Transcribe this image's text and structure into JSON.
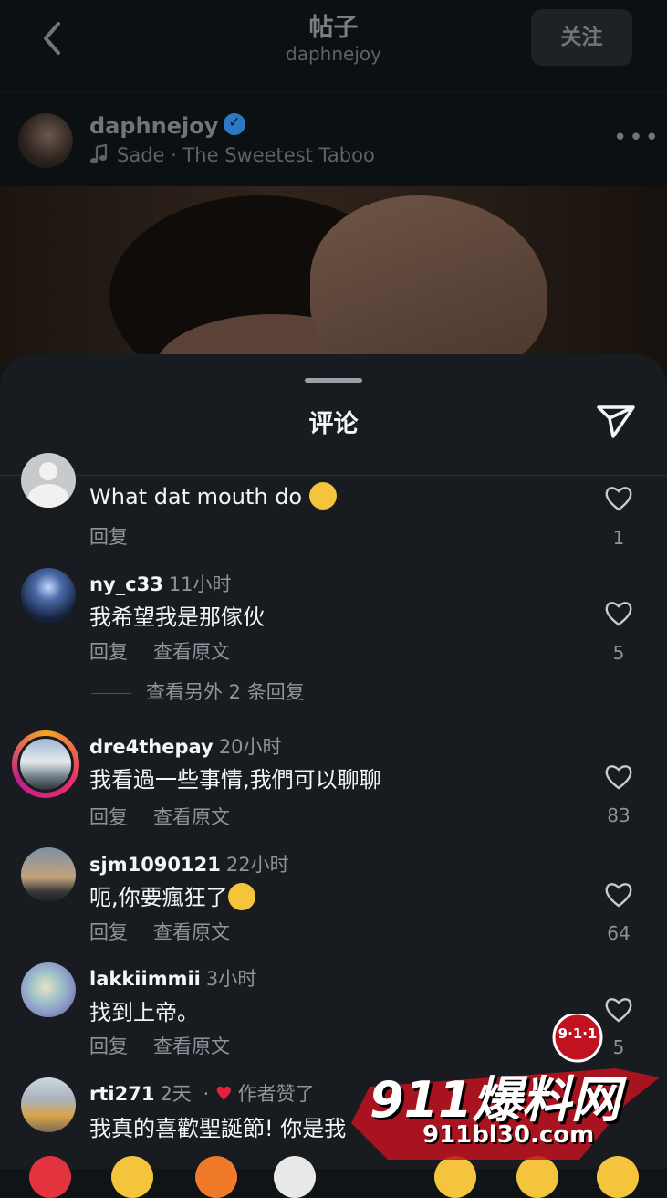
{
  "header": {
    "title": "帖子",
    "subtitle": "daphnejoy",
    "follow_label": "关注"
  },
  "post": {
    "username": "daphnejoy",
    "music": "Sade · The Sweetest Taboo"
  },
  "sheet": {
    "title": "评论"
  },
  "comments": [
    {
      "text": "What dat mouth do",
      "reply_label": "回复",
      "likes": "1"
    },
    {
      "username": "ny_c33",
      "time": "11小时",
      "text": "我希望我是那傢伙",
      "reply_label": "回复",
      "translate_label": "查看原文",
      "likes": "5",
      "more_replies": "查看另外 2 条回复"
    },
    {
      "username": "dre4thepay",
      "time": "20小时",
      "text": "我看過一些事情,我們可以聊聊",
      "reply_label": "回复",
      "translate_label": "查看原文",
      "likes": "83"
    },
    {
      "username": "sjm1090121",
      "time": "22小时",
      "text": "呃,你要瘋狂了",
      "reply_label": "回复",
      "translate_label": "查看原文",
      "likes": "64"
    },
    {
      "username": "lakkiimmii",
      "time": "3小时",
      "text": "找到上帝。",
      "reply_label": "回复",
      "translate_label": "查看原文",
      "likes": "5"
    },
    {
      "username": "rti271",
      "time": "2天",
      "author_liked": "作者赞了",
      "text": "我真的喜歡聖誕節! 你是我"
    }
  ],
  "watermark": {
    "brand": "911爆料网",
    "badge": "9·1·1",
    "url": "911bl30.com"
  },
  "colors": {
    "sheet_bg": "#181c20",
    "text": "#f3f5f7",
    "muted": "#8e949a",
    "liked": "#e4213d"
  }
}
